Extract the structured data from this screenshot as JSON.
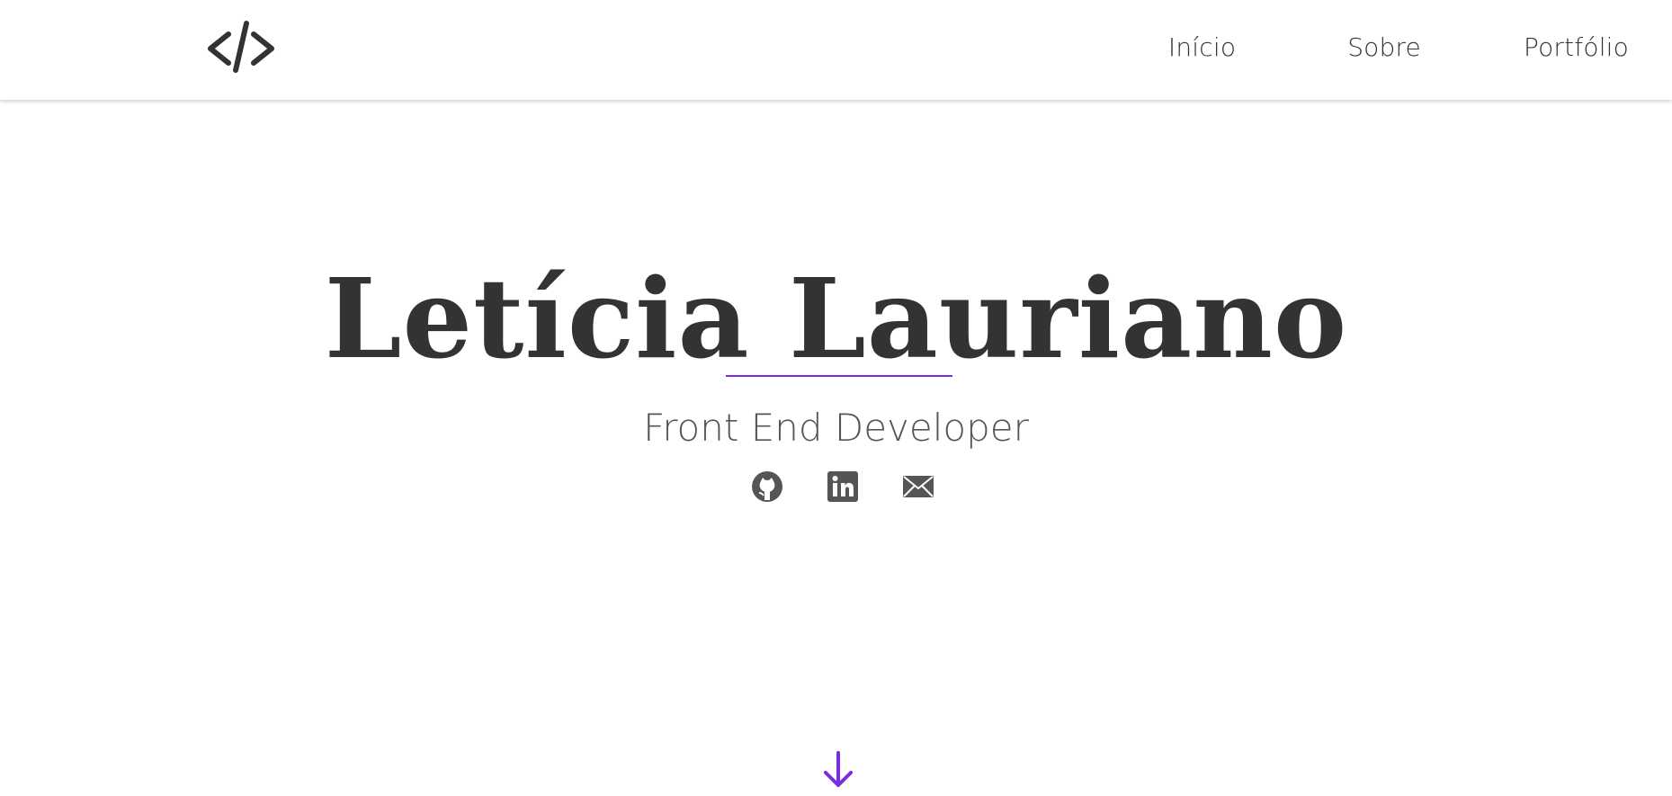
{
  "header": {
    "logo_icon": "code-brackets-icon",
    "nav": [
      {
        "label": "Início"
      },
      {
        "label": "Sobre"
      },
      {
        "label": "Portfólio"
      }
    ]
  },
  "hero": {
    "title": "Letícia Lauriano",
    "subtitle": "Front End Developer",
    "social": [
      {
        "icon": "github-icon"
      },
      {
        "icon": "linkedin-icon"
      },
      {
        "icon": "mail-icon"
      }
    ],
    "scroll_icon": "arrow-down-icon"
  },
  "colors": {
    "accent": "#7b2be0",
    "text": "#333333",
    "subtitle": "#555555",
    "background": "#ffffff"
  }
}
